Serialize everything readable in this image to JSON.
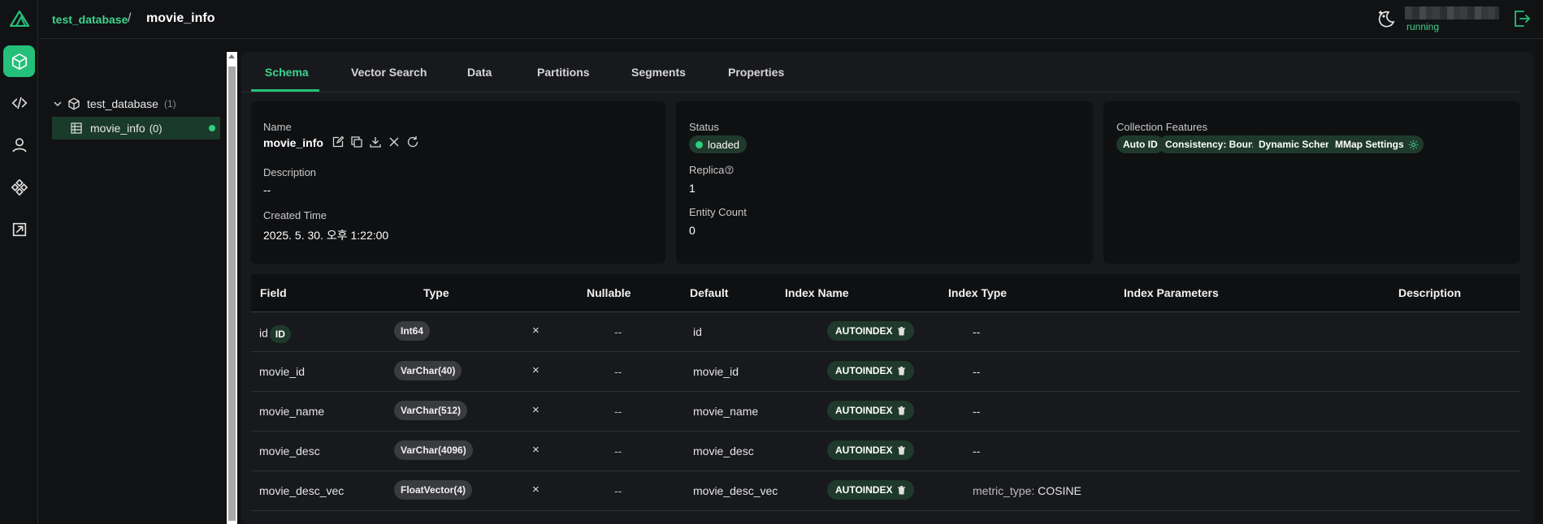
{
  "breadcrumb": {
    "database": "test_database",
    "separator": "/",
    "collection": "movie_info"
  },
  "status": {
    "server": "running"
  },
  "tree": {
    "database": {
      "name": "test_database",
      "count": "(1)"
    },
    "collection": {
      "name": "movie_info",
      "count": "(0)"
    }
  },
  "tabs": [
    "Schema",
    "Vector Search",
    "Data",
    "Partitions",
    "Segments",
    "Properties"
  ],
  "active_tab": "Schema",
  "overview": {
    "name_label": "Name",
    "name_value": "movie_info",
    "description_label": "Description",
    "description_value": "--",
    "created_label": "Created Time",
    "created_value": "2025. 5. 30. 오후 1:22:00",
    "status_label": "Status",
    "status_value": "loaded",
    "replica_label": "Replica",
    "replica_value": "1",
    "entity_label": "Entity Count",
    "entity_value": "0",
    "features_label": "Collection Features",
    "features": [
      "Auto ID",
      "Consistency: Bounded",
      "Dynamic Schema",
      "MMap Settings"
    ]
  },
  "table": {
    "headers": [
      "Field",
      "Type",
      "Nullable",
      "Default",
      "Index Name",
      "Index Type",
      "Index Parameters",
      "Description"
    ],
    "rows": [
      {
        "field": "id",
        "badge": "ID",
        "type": "Int64",
        "nullable": "×",
        "default": "--",
        "index_name": "id",
        "index_type": "AUTOINDEX",
        "params_key": "",
        "params_value": "--",
        "description": ""
      },
      {
        "field": "movie_id",
        "badge": "",
        "type": "VarChar(40)",
        "nullable": "×",
        "default": "--",
        "index_name": "movie_id",
        "index_type": "AUTOINDEX",
        "params_key": "",
        "params_value": "--",
        "description": ""
      },
      {
        "field": "movie_name",
        "badge": "",
        "type": "VarChar(512)",
        "nullable": "×",
        "default": "--",
        "index_name": "movie_name",
        "index_type": "AUTOINDEX",
        "params_key": "",
        "params_value": "--",
        "description": ""
      },
      {
        "field": "movie_desc",
        "badge": "",
        "type": "VarChar(4096)",
        "nullable": "×",
        "default": "--",
        "index_name": "movie_desc",
        "index_type": "AUTOINDEX",
        "params_key": "",
        "params_value": "--",
        "description": ""
      },
      {
        "field": "movie_desc_vec",
        "badge": "",
        "type": "FloatVector(4)",
        "nullable": "×",
        "default": "--",
        "index_name": "movie_desc_vec",
        "index_type": "AUTOINDEX",
        "params_key": "metric_type:",
        "params_value": "COSINE",
        "description": ""
      }
    ]
  },
  "colors": {
    "accent": "#24c07a",
    "accent_text": "#3ed28f",
    "chip_green": "#1f3a2c",
    "background": "#111214",
    "card": "#0f1012"
  },
  "icons": [
    "milvus-logo-icon",
    "collection-cube-icon",
    "code-icon",
    "user-icon",
    "system-icon",
    "external-link-icon",
    "theme-moon-icon",
    "logout-icon",
    "edit-icon",
    "copy-icon",
    "download-icon",
    "drop-icon",
    "refresh-icon",
    "help-icon",
    "settings-gear-icon",
    "trash-icon",
    "table-grid-icon",
    "chevron-down-icon"
  ]
}
